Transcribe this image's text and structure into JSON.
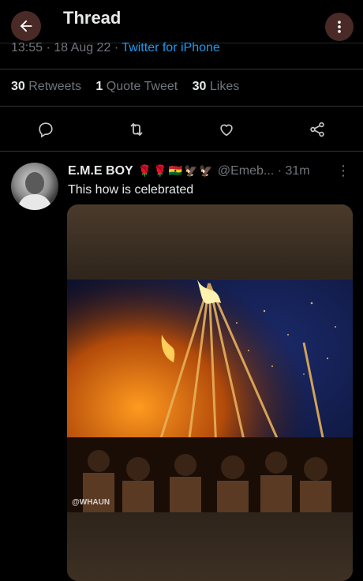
{
  "header": {
    "title": "Thread",
    "back_icon": "arrow-left-icon",
    "more_icon": "more-vertical-icon"
  },
  "tweet": {
    "time": "13:55",
    "date": "18 Aug 22",
    "separator": "·",
    "source": "Twitter for iPhone",
    "stats": [
      {
        "count": "30",
        "label": "Retweets"
      },
      {
        "count": "1",
        "label": "Quote Tweet"
      },
      {
        "count": "30",
        "label": "Likes"
      }
    ],
    "actions": [
      "reply-icon",
      "retweet-icon",
      "like-icon",
      "share-icon"
    ]
  },
  "reply": {
    "name": "E.M.E BOY",
    "emojis": "🌹🌹🇬🇭🦅🦅",
    "handle": "@Emeb...",
    "time": "· 31m",
    "text": "This how is celebrated",
    "media_watermark": "@WHAUN"
  },
  "colors": {
    "background": "#000000",
    "accent": "#1d9bf0",
    "muted": "#71767b",
    "text": "#e7e9ea"
  }
}
